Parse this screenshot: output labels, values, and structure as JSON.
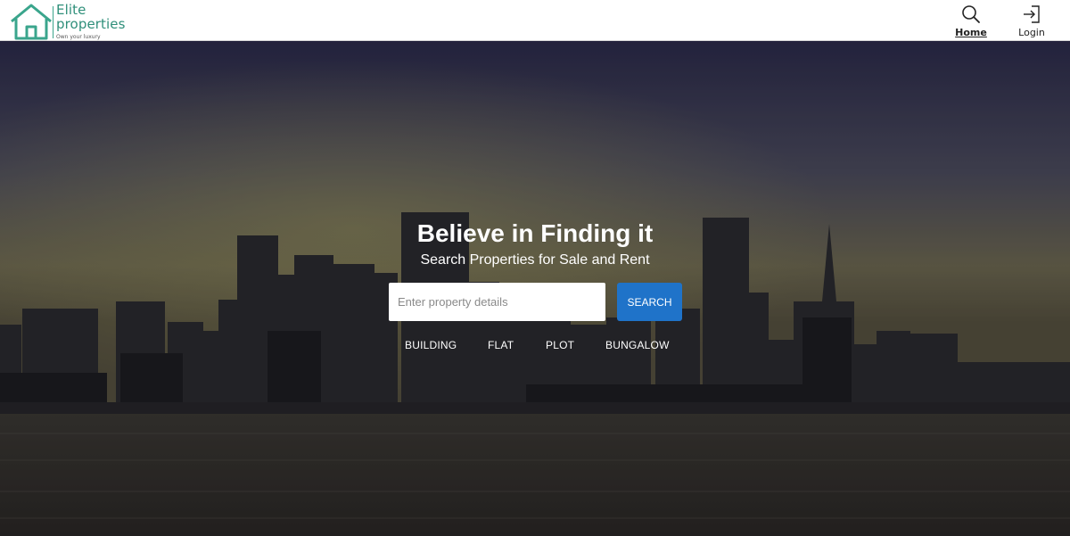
{
  "brand": {
    "name_line1": "Elite",
    "name_line2": "properties",
    "tagline": "Own your luxury",
    "accent_color": "#2f8f7a"
  },
  "nav": {
    "home": {
      "label": "Home",
      "icon": "search-icon"
    },
    "login": {
      "label": "Login",
      "icon": "login-icon"
    }
  },
  "hero": {
    "title": "Believe in Finding it",
    "subtitle": "Search Properties for Sale and Rent",
    "search": {
      "placeholder": "Enter property details",
      "value": "",
      "button_label": "SEARCH",
      "button_color": "#1f73c9"
    },
    "categories": [
      "BUILDING",
      "FLAT",
      "PLOT",
      "BUNGALOW"
    ]
  }
}
